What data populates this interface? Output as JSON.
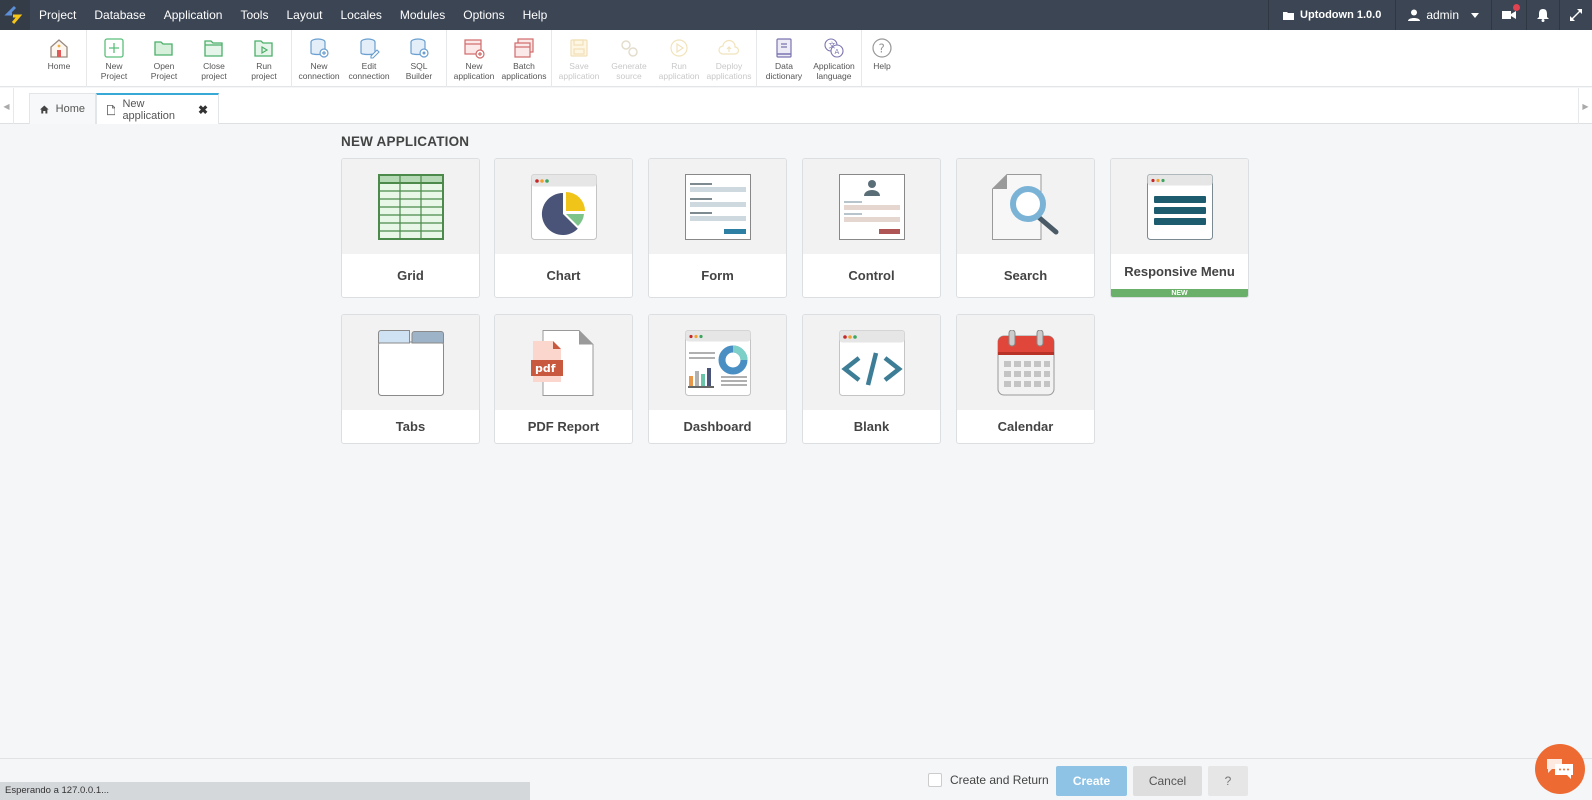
{
  "menubar": {
    "items": [
      "Project",
      "Database",
      "Application",
      "Tools",
      "Layout",
      "Locales",
      "Modules",
      "Options",
      "Help"
    ],
    "project_name": "Uptodown 1.0.0",
    "user": "admin"
  },
  "toolbar": {
    "groups": [
      [
        {
          "label": "Home",
          "icon": "home-icon",
          "disabled": false
        }
      ],
      [
        {
          "label": "New\nProject",
          "icon": "new-project-icon",
          "disabled": false
        },
        {
          "label": "Open\nProject",
          "icon": "open-project-icon",
          "disabled": false
        },
        {
          "label": "Close\nproject",
          "icon": "close-project-icon",
          "disabled": false
        },
        {
          "label": "Run\nproject",
          "icon": "run-project-icon",
          "disabled": false
        }
      ],
      [
        {
          "label": "New\nconnection",
          "icon": "new-connection-icon",
          "disabled": false
        },
        {
          "label": "Edit\nconnection",
          "icon": "edit-connection-icon",
          "disabled": false
        },
        {
          "label": "SQL\nBuilder",
          "icon": "sql-builder-icon",
          "disabled": false
        }
      ],
      [
        {
          "label": "New\napplication",
          "icon": "new-application-icon",
          "disabled": false
        },
        {
          "label": "Batch\napplications",
          "icon": "batch-applications-icon",
          "disabled": false
        }
      ],
      [
        {
          "label": "Save\napplication",
          "icon": "save-application-icon",
          "disabled": true
        },
        {
          "label": "Generate\nsource",
          "icon": "generate-source-icon",
          "disabled": true
        },
        {
          "label": "Run\napplication",
          "icon": "run-application-icon",
          "disabled": true
        },
        {
          "label": "Deploy\napplications",
          "icon": "deploy-applications-icon",
          "disabled": true
        }
      ],
      [
        {
          "label": "Data\ndictionary",
          "icon": "data-dictionary-icon",
          "disabled": false
        },
        {
          "label": "Application\nlanguage",
          "icon": "application-language-icon",
          "disabled": false
        }
      ],
      [
        {
          "label": "Help",
          "icon": "help-icon",
          "disabled": false
        }
      ]
    ]
  },
  "tabs": {
    "home": "Home",
    "active": "New application"
  },
  "main": {
    "title": "NEW APPLICATION",
    "cards": [
      {
        "name": "Grid",
        "icon": "grid-icon"
      },
      {
        "name": "Chart",
        "icon": "chart-icon"
      },
      {
        "name": "Form",
        "icon": "form-icon"
      },
      {
        "name": "Control",
        "icon": "control-icon"
      },
      {
        "name": "Search",
        "icon": "search-icon"
      },
      {
        "name": "Responsive Menu",
        "icon": "responsive-menu-icon",
        "badge": "NEW"
      },
      {
        "name": "Tabs",
        "icon": "tabs-icon"
      },
      {
        "name": "PDF Report",
        "icon": "pdf-report-icon"
      },
      {
        "name": "Dashboard",
        "icon": "dashboard-icon"
      },
      {
        "name": "Blank",
        "icon": "blank-icon"
      },
      {
        "name": "Calendar",
        "icon": "calendar-icon"
      }
    ]
  },
  "footer": {
    "create_and_return": "Create and Return",
    "create": "Create",
    "cancel": "Cancel",
    "help": "?"
  },
  "status": "Esperando a 127.0.0.1...",
  "colors": {
    "menubar": "#3c4553",
    "accent": "#36a9d6",
    "create_button": "#8ec3e6",
    "new_badge": "#6aaf6a",
    "chat": "#ee6a33"
  }
}
